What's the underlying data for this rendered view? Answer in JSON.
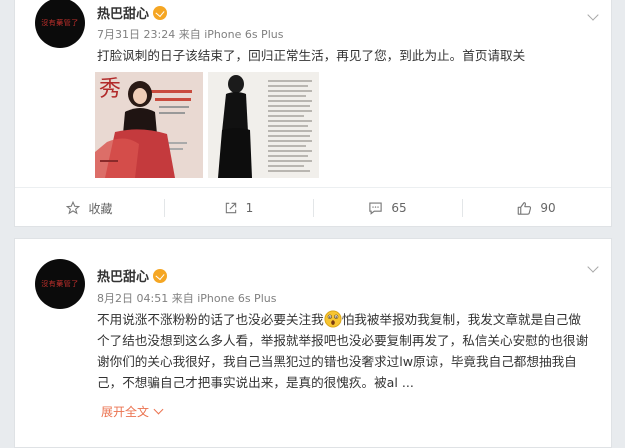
{
  "posts": [
    {
      "avatar_text": "沒有藥管了",
      "username": "热巴甜心",
      "meta_time": "7月31日 23:24",
      "meta_from": "来自",
      "meta_source": "iPhone 6s Plus",
      "text": "打脸讽刺的日子该结束了，回归正常生活，再见了您，到此为止。首页请取关",
      "images": [
        {
          "description": "magazine-cover-photo"
        },
        {
          "description": "magazine-page-photo"
        }
      ],
      "actions": [
        {
          "icon": "star-icon",
          "label": "收藏"
        },
        {
          "icon": "share-icon",
          "label": "1"
        },
        {
          "icon": "comment-icon",
          "label": "65"
        },
        {
          "icon": "like-icon",
          "label": "90"
        }
      ]
    },
    {
      "avatar_text": "沒有藥管了",
      "username": "热巴甜心",
      "meta_time": "8月2日 04:51",
      "meta_from": "来自",
      "meta_source": "iPhone 6s Plus",
      "text_before_emoji": "不用说涨不涨粉粉的话了也没必要关注我",
      "text_after_emoji": "怕我被举报劝我复制，我发文章就是自己做个了结也没想到这么多人看，举报就举报吧也没必要复制再发了，私信关心安慰的也很谢谢你们的关心我很好，我自己当黑犯过的错也没奢求过lw原谅，毕竟我自己都想抽我自己，不想骗自己才把事实说出来，是真的很愧疚。被al ...",
      "expand_label": "展开全文"
    }
  ],
  "colors": {
    "accent": "#eb7350",
    "vip_badge": "#f5a623",
    "background": "#e8ebee"
  }
}
